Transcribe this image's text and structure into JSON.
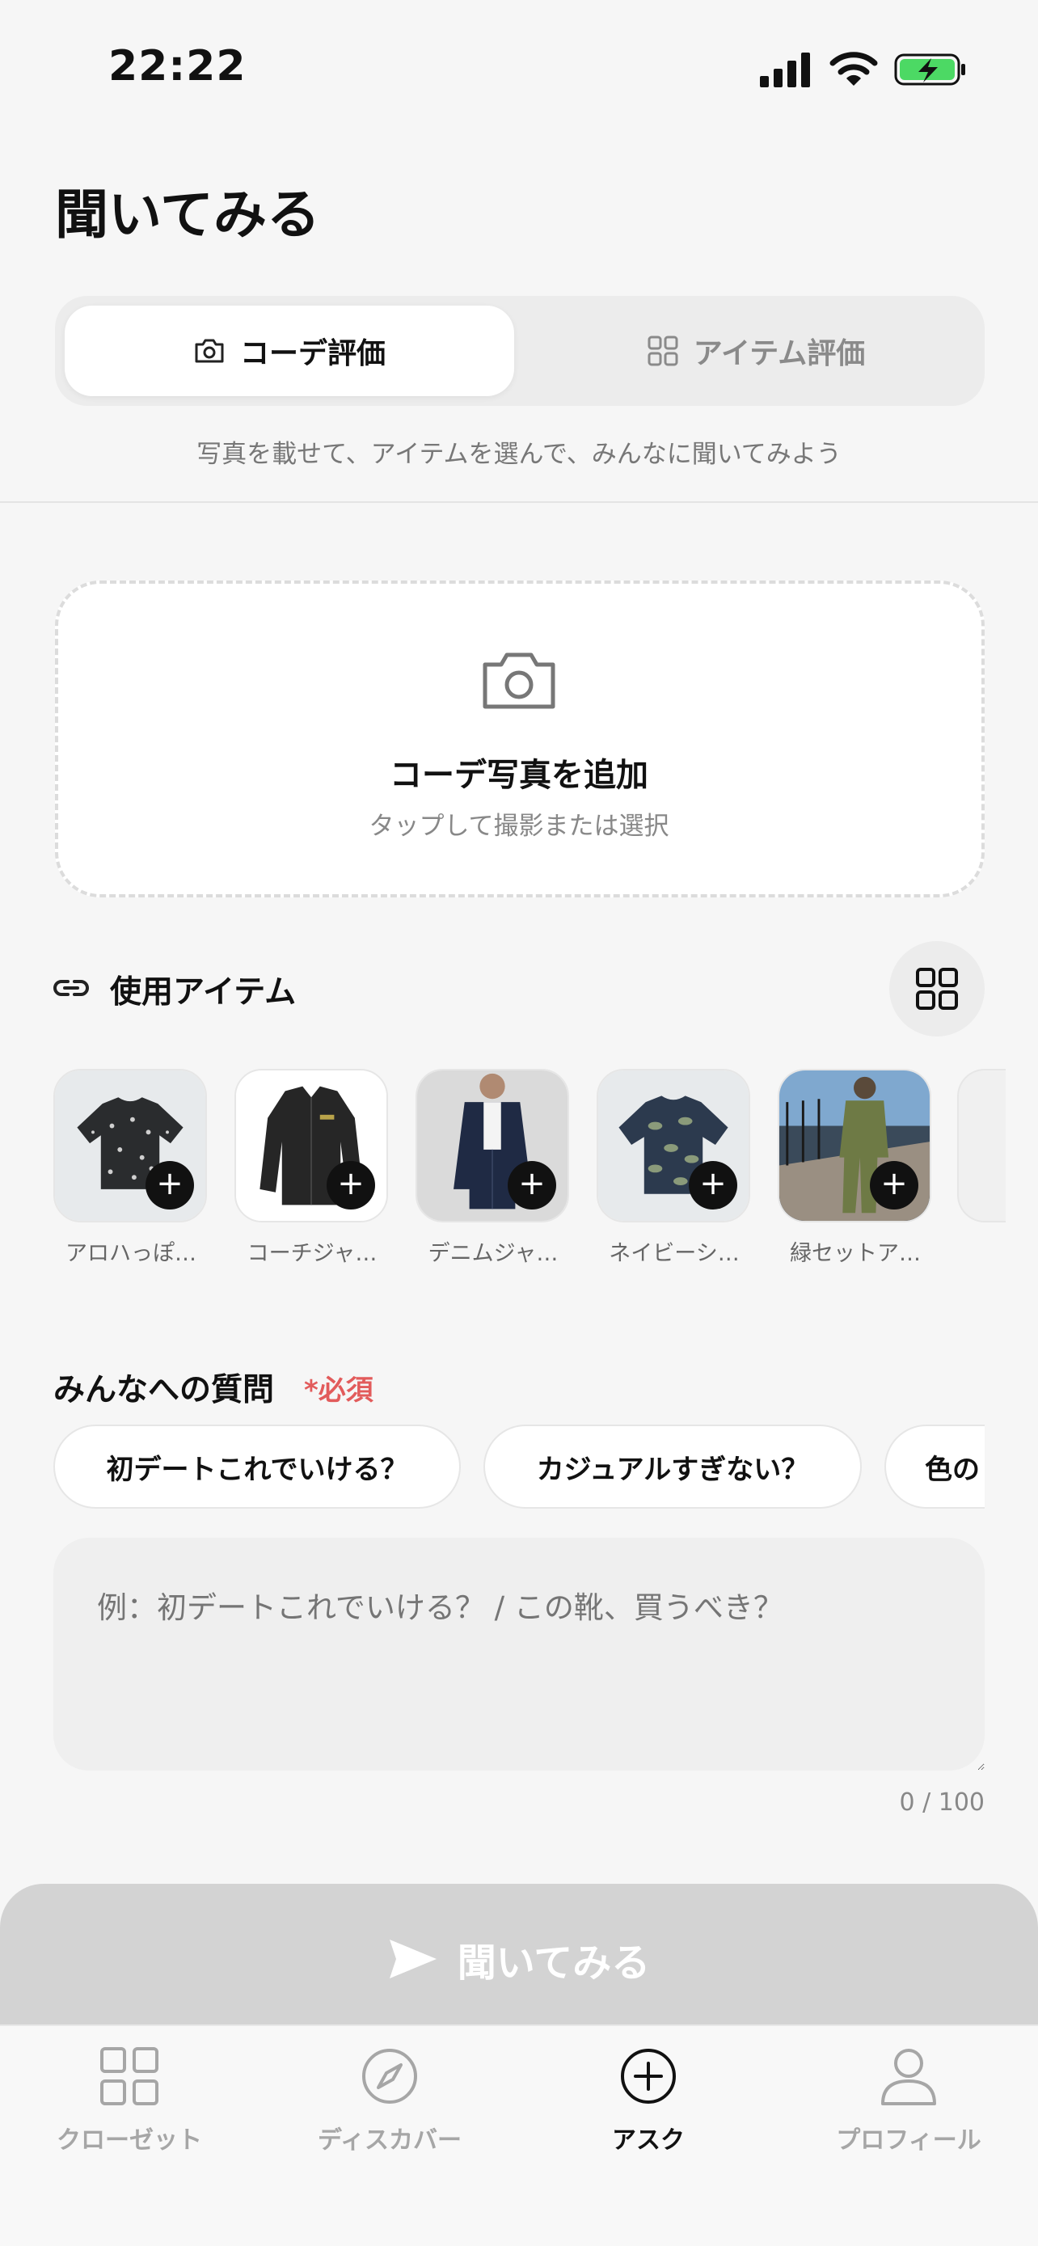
{
  "status_bar": {
    "time": "22:22"
  },
  "page": {
    "title": "聞いてみる"
  },
  "segment": {
    "active_label": "コーデ評価",
    "inactive_label": "アイテム評価",
    "subtitle": "写真を載せて、アイテムを選んで、みんなに聞いてみよう"
  },
  "upload": {
    "title": "コーデ写真を追加",
    "subtitle": "タップして撮影または選択"
  },
  "items_section": {
    "title": "使用アイテム",
    "items": [
      {
        "label": "アロハっぽ…",
        "icon": "shirt-icon"
      },
      {
        "label": "コーチジャ…",
        "icon": "jacket-icon"
      },
      {
        "label": "デニムジャ…",
        "icon": "denim-jacket-icon"
      },
      {
        "label": "ネイビーシ…",
        "icon": "shirt-icon"
      },
      {
        "label": "緑セットア…",
        "icon": "outfit-photo-icon"
      }
    ]
  },
  "question_section": {
    "title": "みんなへの質問",
    "required": "*必須",
    "chips": [
      "初デートこれでいける？",
      "カジュアルすぎない？",
      "色の"
    ],
    "placeholder": "例：初デートこれでいける？ / この靴、買うべき？",
    "counter": "0 / 100"
  },
  "submit": {
    "label": "聞いてみる"
  },
  "tabbar": {
    "items": [
      {
        "label": "クローゼット",
        "icon": "grid-icon"
      },
      {
        "label": "ディスカバー",
        "icon": "compass-icon"
      },
      {
        "label": "アスク",
        "icon": "plus-circle-icon"
      },
      {
        "label": "プロフィール",
        "icon": "person-icon"
      }
    ],
    "active_index": 2
  },
  "colors": {
    "required": "#e25b5b",
    "submit_disabled": "#d3d3d3",
    "accent": "#111111",
    "battery": "#4cd964"
  }
}
